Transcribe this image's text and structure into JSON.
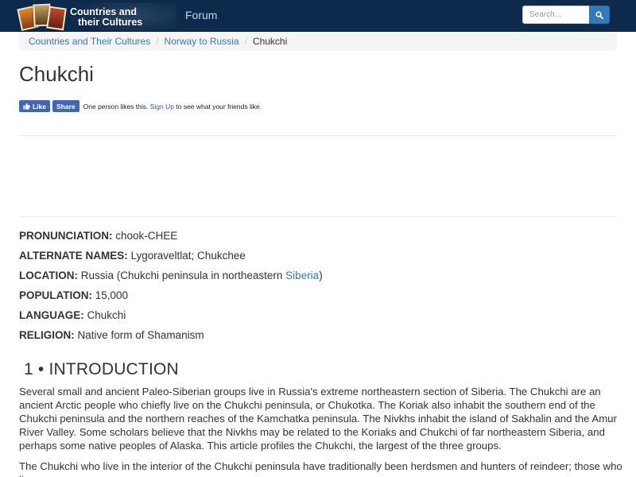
{
  "header": {
    "logo_line1": "Countries and",
    "logo_line2": "their Cultures",
    "nav_forum": "Forum",
    "search_placeholder": "Search..."
  },
  "breadcrumb": {
    "items": [
      "Countries and Their Cultures",
      "Norway to Russia",
      "Chukchi"
    ],
    "separator": "/"
  },
  "page": {
    "title": "Chukchi"
  },
  "social": {
    "like_label": "Like",
    "share_label": "Share",
    "likes_text": "One person likes this.",
    "signup_link": "Sign Up",
    "signup_suffix": "to see what your friends like."
  },
  "facts": [
    {
      "label": "PRONUNCIATION:",
      "value": "chook-CHEE"
    },
    {
      "label": "ALTERNATE NAMES:",
      "value": "Lygoraveltlat; Chukchee"
    },
    {
      "label": "LOCATION:",
      "value_before": "Russia (Chukchi peninsula in northeastern",
      "link": "Siberia",
      "value_after": ")"
    },
    {
      "label": "POPULATION:",
      "value": "15,000"
    },
    {
      "label": "LANGUAGE:",
      "value": "Chukchi"
    },
    {
      "label": "RELIGION:",
      "value": "Native form of Shamanism"
    }
  ],
  "introduction": {
    "heading": "1 • INTRODUCTION",
    "paragraph1": "Several small and ancient Paleo-Siberian groups live in Russia's extreme northeastern section of Siberia. The Chukchi are an ancient Arctic people who chiefly live on the Chukchi peninsula, or Chukotka. The Koriak also inhabit the southern end of the Chukchi peninsula and the northern reaches of the Kamchatka peninsula. The Nivkhs inhabit the island of Sakhalin and the Amur River Valley. Some scholars believe that the Nivkhs may be related to the Koriaks and Chukchi of far northeastern Siberia, and perhaps some native peoples of Alaska. This article profiles the Chukchi, the largest of the three groups.",
    "paragraph2": "The Chukchi who live in the interior of the Chukchi peninsula have traditionally been herdsmen and hunters of reindeer; those who live"
  },
  "colors": {
    "navbar": "#0d2a4c",
    "link": "#337ab7",
    "search_button": "#337ab7",
    "facebook": "#4267b2"
  }
}
